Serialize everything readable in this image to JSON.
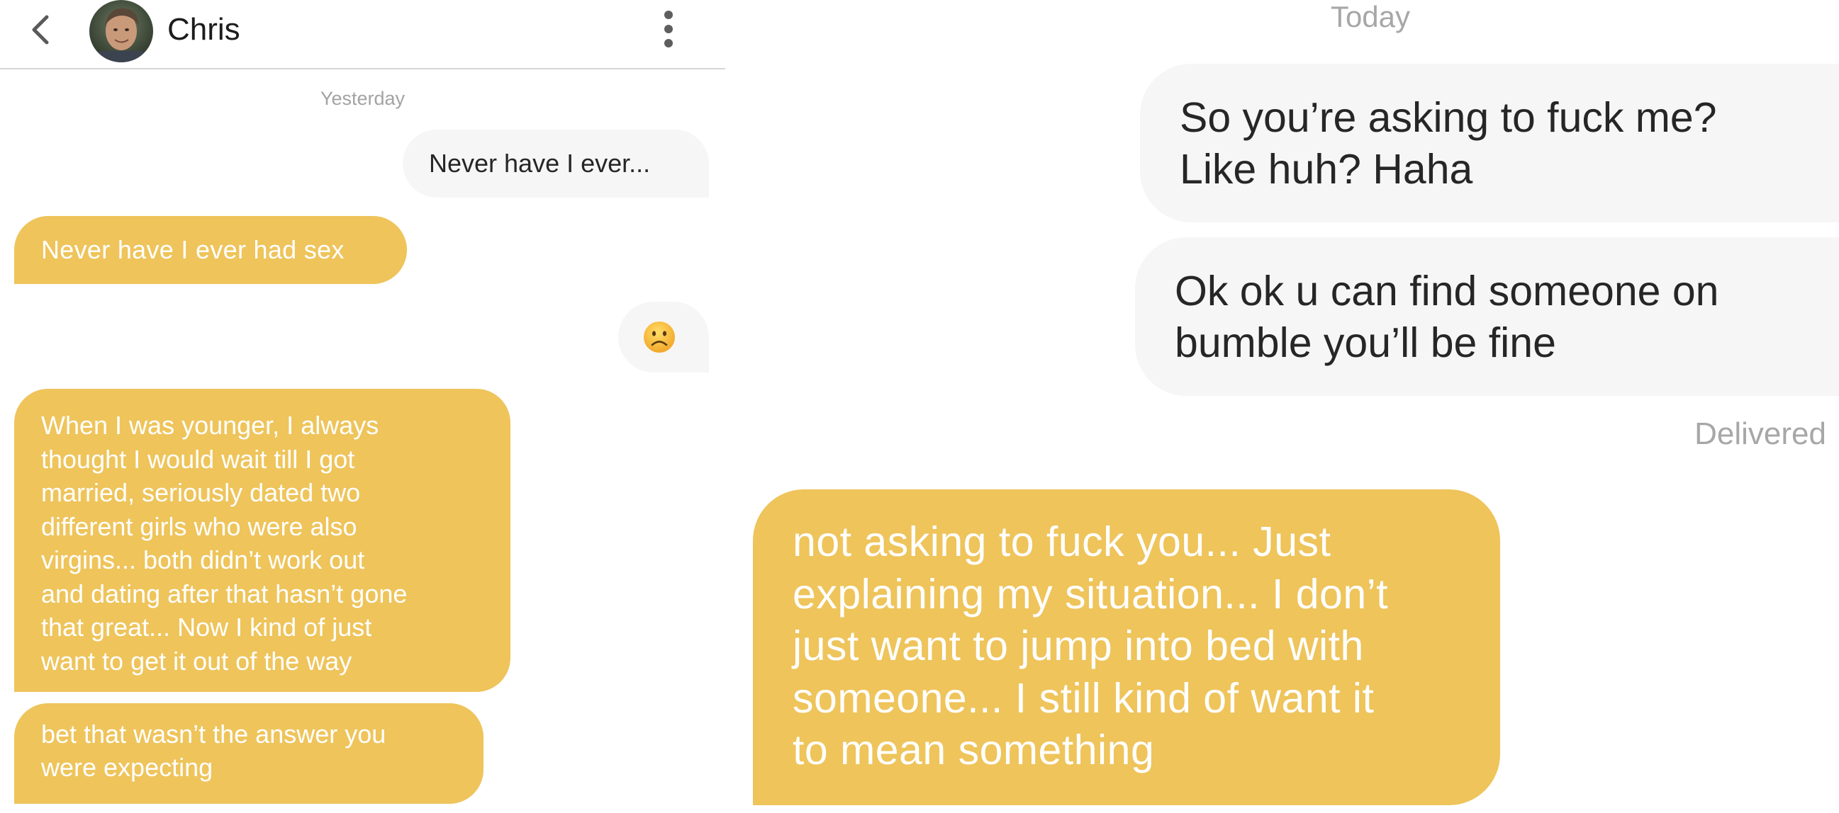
{
  "left": {
    "header": {
      "contact_name": "Chris",
      "back_icon": "chevron-left-icon",
      "menu_icon": "kebab-menu-icon"
    },
    "date_label": "Yesterday",
    "messages": [
      {
        "direction": "outgoing",
        "text": "Never have I ever..."
      },
      {
        "direction": "incoming",
        "text": "Never have I ever had sex"
      },
      {
        "direction": "outgoing",
        "emoji": "frowning-face"
      },
      {
        "direction": "incoming",
        "text": "When I was younger, I always\nthought I would wait till I got\nmarried, seriously dated two\ndifferent girls who were also\nvirgins... both didn’t work out\nand dating after that hasn’t gone\nthat great... Now I kind of just\nwant to get it out of the way"
      },
      {
        "direction": "incoming",
        "text": "bet that wasn’t the answer you\nwere expecting"
      }
    ]
  },
  "right": {
    "date_label": "Today",
    "messages": [
      {
        "direction": "outgoing",
        "text": "So you’re asking to fuck me?\nLike huh? Haha"
      },
      {
        "direction": "outgoing",
        "text": "Ok ok u can find someone on\nbumble you’ll be fine"
      },
      {
        "direction": "incoming",
        "text": "not asking to fuck you... Just\nexplaining my situation... I don’t\njust want to jump into bed with\nsomeone... I still kind of want it\nto mean something"
      }
    ],
    "status": "Delivered"
  },
  "colors": {
    "incoming_bubble": "#eec45b",
    "outgoing_bubble": "#f6f6f6",
    "timestamp_text": "#a3a3a3"
  }
}
